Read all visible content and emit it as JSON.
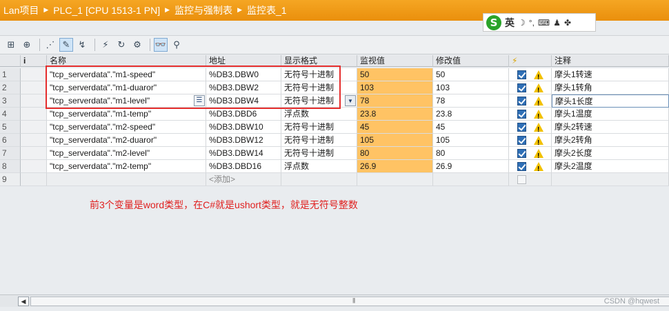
{
  "breadcrumb": [
    "Lan项目",
    "PLC_1 [CPU 1513-1 PN]",
    "监控与强制表",
    "监控表_1"
  ],
  "ime": {
    "label": "英"
  },
  "columns": {
    "info": "i",
    "name": "名称",
    "address": "地址",
    "format": "显示格式",
    "monitor": "监视值",
    "modify": "修改值",
    "lightning": "⚡",
    "comment": "注释"
  },
  "rows": [
    {
      "num": "1",
      "name": "\"tcp_serverdata\".\"m1-speed\"",
      "address": "%DB3.DBW0",
      "format": "无符号十进制",
      "monitor": "50",
      "modify": "50",
      "comment": "摩头1转速"
    },
    {
      "num": "2",
      "name": "\"tcp_serverdata\".\"m1-duaror\"",
      "address": "%DB3.DBW2",
      "format": "无符号十进制",
      "monitor": "103",
      "modify": "103",
      "comment": "摩头1转角"
    },
    {
      "num": "3",
      "name": "\"tcp_serverdata\".\"m1-level\"",
      "address": "%DB3.DBW4",
      "format": "无符号十进制",
      "monitor": "78",
      "modify": "78",
      "comment": "摩头1长度"
    },
    {
      "num": "4",
      "name": "\"tcp_serverdata\".\"m1-temp\"",
      "address": "%DB3.DBD6",
      "format": "浮点数",
      "monitor": "23.8",
      "modify": "23.8",
      "comment": "摩头1温度"
    },
    {
      "num": "5",
      "name": "\"tcp_serverdata\".\"m2-speed\"",
      "address": "%DB3.DBW10",
      "format": "无符号十进制",
      "monitor": "45",
      "modify": "45",
      "comment": "摩头2转速"
    },
    {
      "num": "6",
      "name": "\"tcp_serverdata\".\"m2-duaror\"",
      "address": "%DB3.DBW12",
      "format": "无符号十进制",
      "monitor": "105",
      "modify": "105",
      "comment": "摩头2转角"
    },
    {
      "num": "7",
      "name": "\"tcp_serverdata\".\"m2-level\"",
      "address": "%DB3.DBW14",
      "format": "无符号十进制",
      "monitor": "80",
      "modify": "80",
      "comment": "摩头2长度"
    },
    {
      "num": "8",
      "name": "\"tcp_serverdata\".\"m2-temp\"",
      "address": "%DB3.DBD16",
      "format": "浮点数",
      "monitor": "26.9",
      "modify": "26.9",
      "comment": "摩头2温度"
    }
  ],
  "empty_row": {
    "num": "9",
    "address": "<添加>"
  },
  "annotation": "前3个变量是word类型，在C#就是ushort类型，就是无符号整数",
  "watermark": "CSDN @hqwest",
  "colors": {
    "titlebar": "#f5a623",
    "monitor_cell": "#ffc364",
    "annotation": "#e0201f"
  }
}
